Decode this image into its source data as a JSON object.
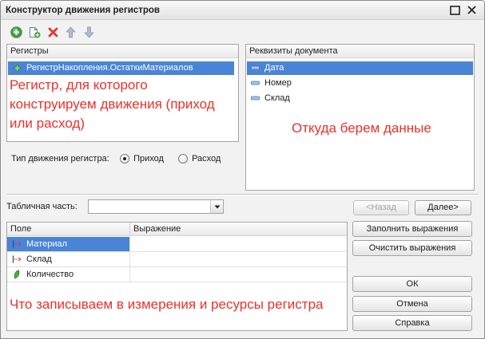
{
  "window": {
    "title": "Конструктор движения регистров",
    "maximize_icon": "maximize-icon",
    "close_icon": "close-icon"
  },
  "toolbar": {
    "items": [
      {
        "icon": "add-icon"
      },
      {
        "icon": "copy-add-icon"
      },
      {
        "icon": "delete-icon"
      },
      {
        "icon": "move-up-icon"
      },
      {
        "icon": "move-down-icon"
      }
    ]
  },
  "registers": {
    "header": "Регистры",
    "items": [
      {
        "label": "РегистрНакопления.ОстаткиМатериалов",
        "icon": "accumulation-register-icon",
        "selected": true
      }
    ],
    "note_lines": [
      "Регистр, для которого",
      "конструируем движения (приход",
      "или расход)"
    ]
  },
  "document_attributes": {
    "header": "Реквизиты документа",
    "items": [
      {
        "label": "Дата",
        "icon": "attribute-icon",
        "selected": true
      },
      {
        "label": "Номер",
        "icon": "attribute-icon",
        "selected": false
      },
      {
        "label": "Склад",
        "icon": "attribute-icon",
        "selected": false
      }
    ],
    "note": "Откуда берем данные"
  },
  "movement_type": {
    "label": "Тип движения регистра:",
    "options": [
      {
        "label": "Приход",
        "checked": true
      },
      {
        "label": "Расход",
        "checked": false
      }
    ]
  },
  "tabular_section": {
    "label": "Табличная часть:",
    "value": "",
    "dropdown_icon": "chevron-down-icon"
  },
  "navigation": {
    "back": {
      "label": "<Назад",
      "enabled": false
    },
    "next": {
      "label": "Далее>",
      "enabled": true
    }
  },
  "fields_table": {
    "columns": [
      "Поле",
      "Выражение"
    ],
    "rows": [
      {
        "field": "Материал",
        "expression": "",
        "icon": "dimension-icon",
        "selected": true
      },
      {
        "field": "Склад",
        "expression": "",
        "icon": "dimension-icon",
        "selected": false
      },
      {
        "field": "Количество",
        "expression": "",
        "icon": "resource-icon",
        "selected": false
      }
    ],
    "note": "Что записываем в измерения и ресурсы регистра"
  },
  "actions": {
    "fill": "Заполнить выражения",
    "clear": "Очистить выражения",
    "ok": "ОК",
    "cancel": "Отмена",
    "help": "Справка"
  },
  "colors": {
    "selection": "#4a84d6",
    "note": "#e8322c",
    "add": "#3da33d",
    "delete": "#e03a2e",
    "disabled_text": "#a3a3a3"
  }
}
